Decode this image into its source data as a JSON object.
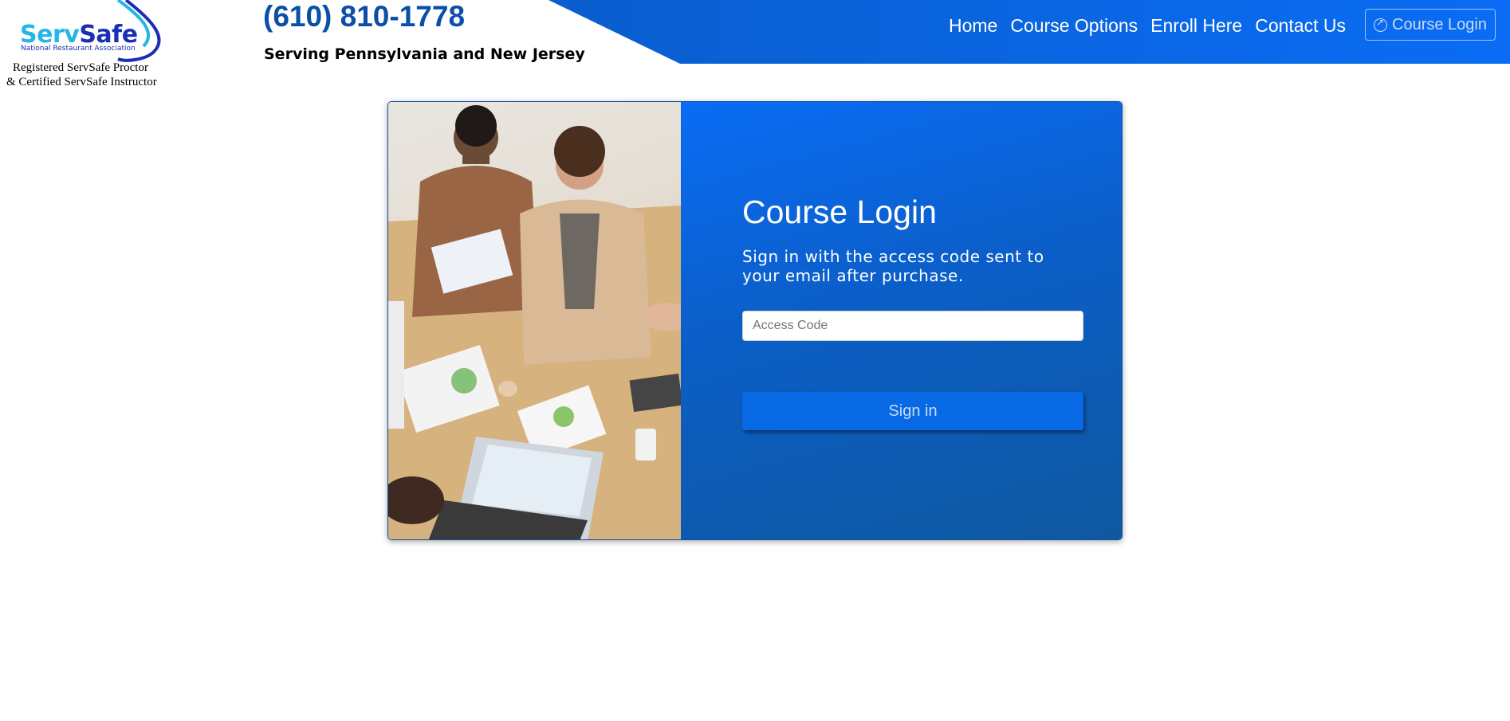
{
  "logo": {
    "brand_part1": "Serv",
    "brand_part2": "Safe",
    "brand_sub": "National Restaurant Association",
    "caption_line1": "Registered ServSafe Proctor",
    "caption_line2": "& Certified ServSafe Instructor"
  },
  "header": {
    "phone": "(610) 810-1778",
    "tagline": "Serving Pennsylvania and New Jersey"
  },
  "nav": {
    "items": [
      {
        "label": "Home"
      },
      {
        "label": "Course Options"
      },
      {
        "label": "Enroll Here"
      },
      {
        "label": "Contact Us"
      }
    ],
    "login_label": "Course Login",
    "login_icon": "arrow-up-right-circle-icon"
  },
  "login": {
    "title": "Course Login",
    "subtitle": "Sign in with the access code sent to your email after purchase.",
    "access_code_placeholder": "Access Code",
    "access_code_value": "",
    "sign_in_label": "Sign in"
  },
  "colors": {
    "brand_blue": "#0a6cf5",
    "phone_blue": "#0b4fa8",
    "panel_dark": "#0f58a0"
  }
}
